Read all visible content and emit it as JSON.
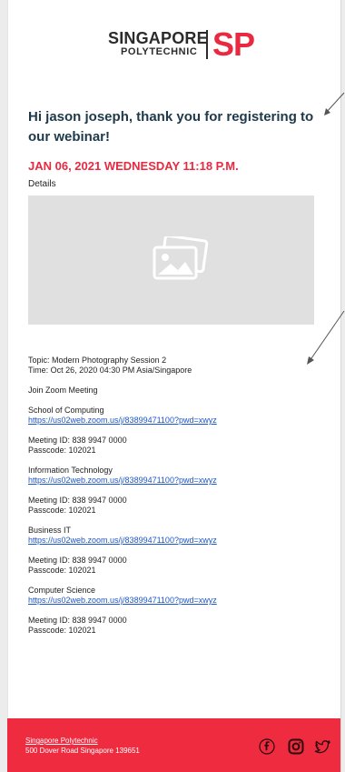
{
  "logo": {
    "line1": "SINGAPORE",
    "line2": "POLYTECHNIC",
    "mark": "SP"
  },
  "greeting": "Hi jason joseph, thank you for registering to our webinar!",
  "datetime": "JAN 06, 2021 WEDNESDAY 11:18 P.M.",
  "details_label": "Details",
  "image_icon": "image-placeholder-icon",
  "topic": "Topic: Modern Photography Session 2",
  "time": "Time: Oct 26, 2020 04:30 PM Asia/Singapore",
  "join": "Join Zoom Meeting",
  "sessions": [
    {
      "name": "School of Computing",
      "link": "https://us02web.zoom.us/j/83899471100?pwd=xwyz",
      "meeting_id": "Meeting ID: 838 9947 0000",
      "passcode": "Passcode: 102021"
    },
    {
      "name": "Information Technology",
      "link": "https://us02web.zoom.us/j/83899471100?pwd=xwyz",
      "meeting_id": "Meeting ID: 838 9947 0000",
      "passcode": "Passcode: 102021"
    },
    {
      "name": "Business IT",
      "link": "https://us02web.zoom.us/j/83899471100?pwd=xwyz",
      "meeting_id": "Meeting ID: 838 9947 0000",
      "passcode": "Passcode: 102021"
    },
    {
      "name": "Computer Science",
      "link": "https://us02web.zoom.us/j/83899471100?pwd=xwyz",
      "meeting_id": "Meeting ID: 838 9947 0000",
      "passcode": "Passcode: 102021"
    }
  ],
  "footer": {
    "link": "Singapore Polytechnic",
    "address": "500 Dover Road Singapore 139651",
    "icons": [
      "facebook-icon",
      "instagram-icon",
      "twitter-icon"
    ]
  },
  "colors": {
    "brand_red": "#ee2b3f",
    "heading": "#1e3a4a",
    "link": "#1a55c9"
  }
}
